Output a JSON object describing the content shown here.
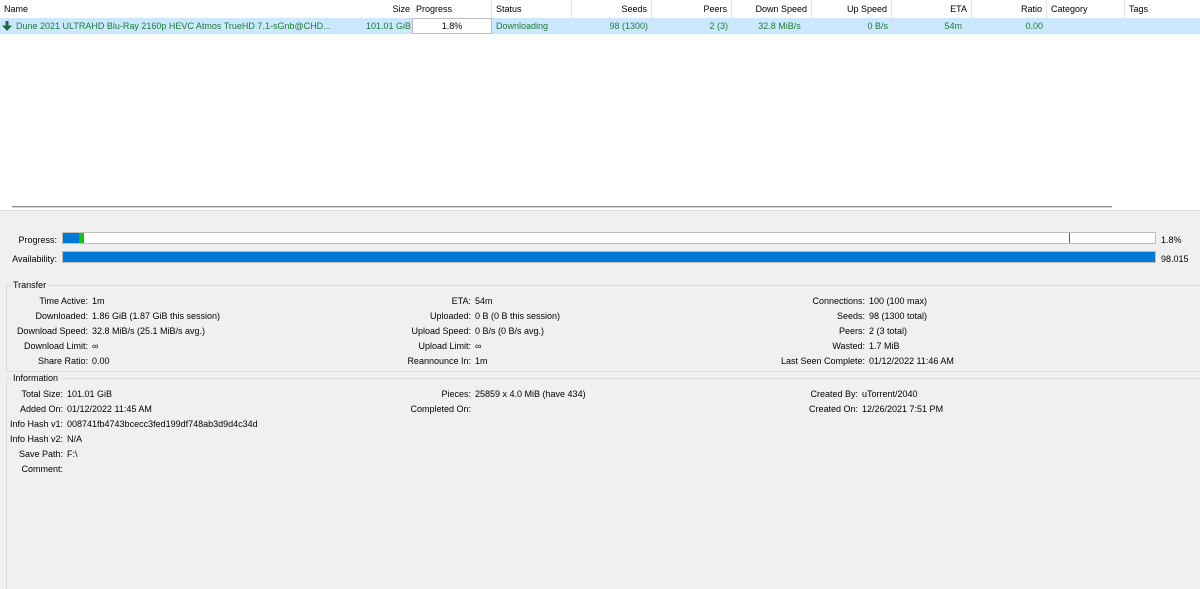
{
  "columns": {
    "name": "Name",
    "size": "Size",
    "progress": "Progress",
    "status": "Status",
    "seeds": "Seeds",
    "peers": "Peers",
    "down_speed": "Down Speed",
    "up_speed": "Up Speed",
    "eta": "ETA",
    "ratio": "Ratio",
    "category": "Category",
    "tags": "Tags"
  },
  "sort_indicator": "^",
  "torrent": {
    "name": "Dune 2021 ULTRAHD Blu-Ray 2160p HEVC Atmos TrueHD 7.1-sGnb@CHD...",
    "size": "101.01 GiB",
    "progress": "1.8%",
    "status": "Downloading",
    "seeds": "98 (1300)",
    "peers": "2 (3)",
    "down_speed": "32.8 MiB/s",
    "up_speed": "0 B/s",
    "eta": "54m",
    "ratio": "0.00",
    "category": "",
    "tags": ""
  },
  "bars": {
    "progress_label": "Progress:",
    "progress_value": "1.8%",
    "availability_label": "Availability:",
    "availability_value": "98.015"
  },
  "transfer": {
    "title": "Transfer",
    "time_active_k": "Time Active:",
    "time_active_v": "1m",
    "downloaded_k": "Downloaded:",
    "downloaded_v": "1.86 GiB (1.87 GiB this session)",
    "download_speed_k": "Download Speed:",
    "download_speed_v": "32.8 MiB/s (25.1 MiB/s avg.)",
    "download_limit_k": "Download Limit:",
    "download_limit_v": "∞",
    "share_ratio_k": "Share Ratio:",
    "share_ratio_v": "0.00",
    "eta_k": "ETA:",
    "eta_v": "54m",
    "uploaded_k": "Uploaded:",
    "uploaded_v": "0 B (0 B this session)",
    "upload_speed_k": "Upload Speed:",
    "upload_speed_v": "0 B/s (0 B/s avg.)",
    "upload_limit_k": "Upload Limit:",
    "upload_limit_v": "∞",
    "reannounce_k": "Reannounce In:",
    "reannounce_v": "1m",
    "connections_k": "Connections:",
    "connections_v": "100 (100 max)",
    "seeds_k": "Seeds:",
    "seeds_v": "98 (1300 total)",
    "peers_k": "Peers:",
    "peers_v": "2 (3 total)",
    "wasted_k": "Wasted:",
    "wasted_v": "1.7 MiB",
    "last_seen_k": "Last Seen Complete:",
    "last_seen_v": "01/12/2022 11:46 AM"
  },
  "information": {
    "title": "Information",
    "total_size_k": "Total Size:",
    "total_size_v": "101.01 GiB",
    "added_on_k": "Added On:",
    "added_on_v": "01/12/2022 11:45 AM",
    "hash_v1_k": "Info Hash v1:",
    "hash_v1_v": "008741fb4743bcecc3fed199df748ab3d9d4c34d",
    "hash_v2_k": "Info Hash v2:",
    "hash_v2_v": "N/A",
    "save_path_k": "Save Path:",
    "save_path_v": "F:\\",
    "comment_k": "Comment:",
    "comment_v": "",
    "pieces_k": "Pieces:",
    "pieces_v": "25859 x 4.0 MiB (have 434)",
    "completed_on_k": "Completed On:",
    "completed_on_v": "",
    "created_by_k": "Created By:",
    "created_by_v": "uTorrent/2040",
    "created_on_k": "Created On:",
    "created_on_v": "12/26/2021 7:51 PM"
  },
  "colors": {
    "row_selected": "#cce8ff",
    "status_text": "#1e7b34",
    "bar_blue": "#0078d7",
    "bar_green": "#16c60c"
  }
}
